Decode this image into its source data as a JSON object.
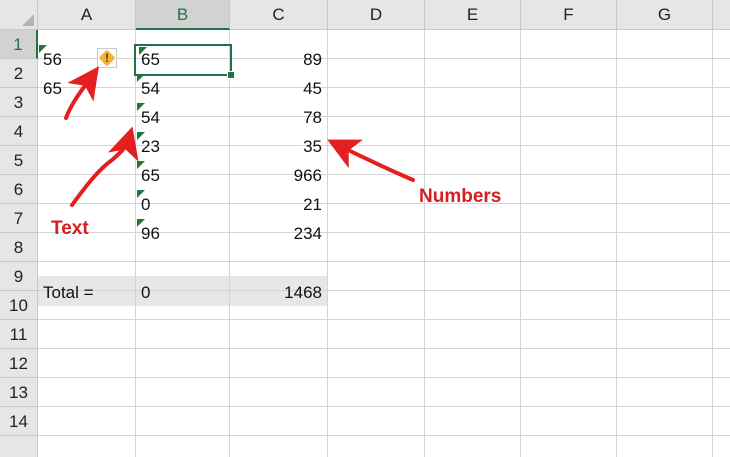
{
  "columns": [
    "A",
    "B",
    "C",
    "D",
    "E",
    "F",
    "G"
  ],
  "rows": [
    "1",
    "2",
    "3",
    "4",
    "5",
    "6",
    "7",
    "8",
    "9",
    "10",
    "11",
    "12",
    "13",
    "14"
  ],
  "cells": {
    "a1": "56",
    "a2": "65",
    "a9": "Total =",
    "b1": "65",
    "b2": "54",
    "b3": "54",
    "b4": "23",
    "b5": "65",
    "b6": "0",
    "b7": "96",
    "b9": "0",
    "c1": "89",
    "c2": "45",
    "c3": "78",
    "c4": "35",
    "c5": "966",
    "c6": "21",
    "c7": "234",
    "c9": "1468"
  },
  "error_indicator_icon": "warning-diamond-icon",
  "error_indicator_mark": "!",
  "annotations": {
    "text_label": "Text",
    "numbers_label": "Numbers"
  },
  "colors": {
    "accent": "#217346",
    "annotation": "#d42020",
    "error_triangle": "#1f7a3a",
    "total_row_fill": "#e7e7e7"
  }
}
